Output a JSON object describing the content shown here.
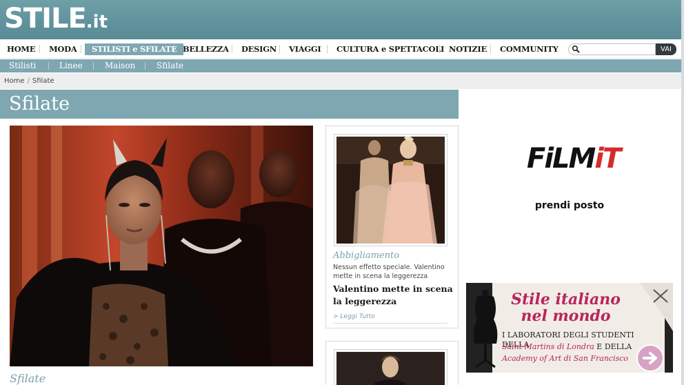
{
  "header": {
    "logo_main": "STILE",
    "logo_tld": ".it"
  },
  "mainnav": {
    "items": [
      "HOME",
      "MODA",
      "STILISTI e SFILATE",
      "BELLEZZA",
      "DESIGN",
      "VIAGGI",
      "CULTURA e SPETTACOLI",
      "NOTIZIE",
      "COMMUNITY"
    ],
    "active_index": 2
  },
  "search": {
    "value": "",
    "button_label": "VAI"
  },
  "subnav": {
    "items": [
      "Stilisti",
      "Linee",
      "Maison",
      "Sfilate"
    ]
  },
  "breadcrumb": {
    "items": [
      "Home",
      "Sfilate"
    ],
    "separator": "/"
  },
  "page": {
    "title": "Sfilate"
  },
  "feature": {
    "caption": "Sfilate"
  },
  "cards": [
    {
      "category": "Abbigliamento",
      "description": "Nessun effetto speciale. Valentino mette in scena la leggerezza",
      "headline": "Valentino mette in scena la leggerezza",
      "more": "> Leggi Tutto"
    }
  ],
  "ads": {
    "film": {
      "logo_a": "FiLM",
      "logo_b": "iT",
      "tagline": "prendi posto"
    },
    "stile": {
      "title": "Stile italiano nel mondo",
      "line1": "I LABORATORI DEGLI STUDENTI DELLA",
      "line2_a": "Saint Martins di Londra",
      "line2_b": "E DELLA",
      "line3": "Academy of Art di San Francisco"
    }
  },
  "colors": {
    "accent": "#7ea7b2",
    "header": "#5f929c",
    "caption": "#7a9fab",
    "film_red": "#d62b2b",
    "ad_pink": "#b8245b"
  }
}
